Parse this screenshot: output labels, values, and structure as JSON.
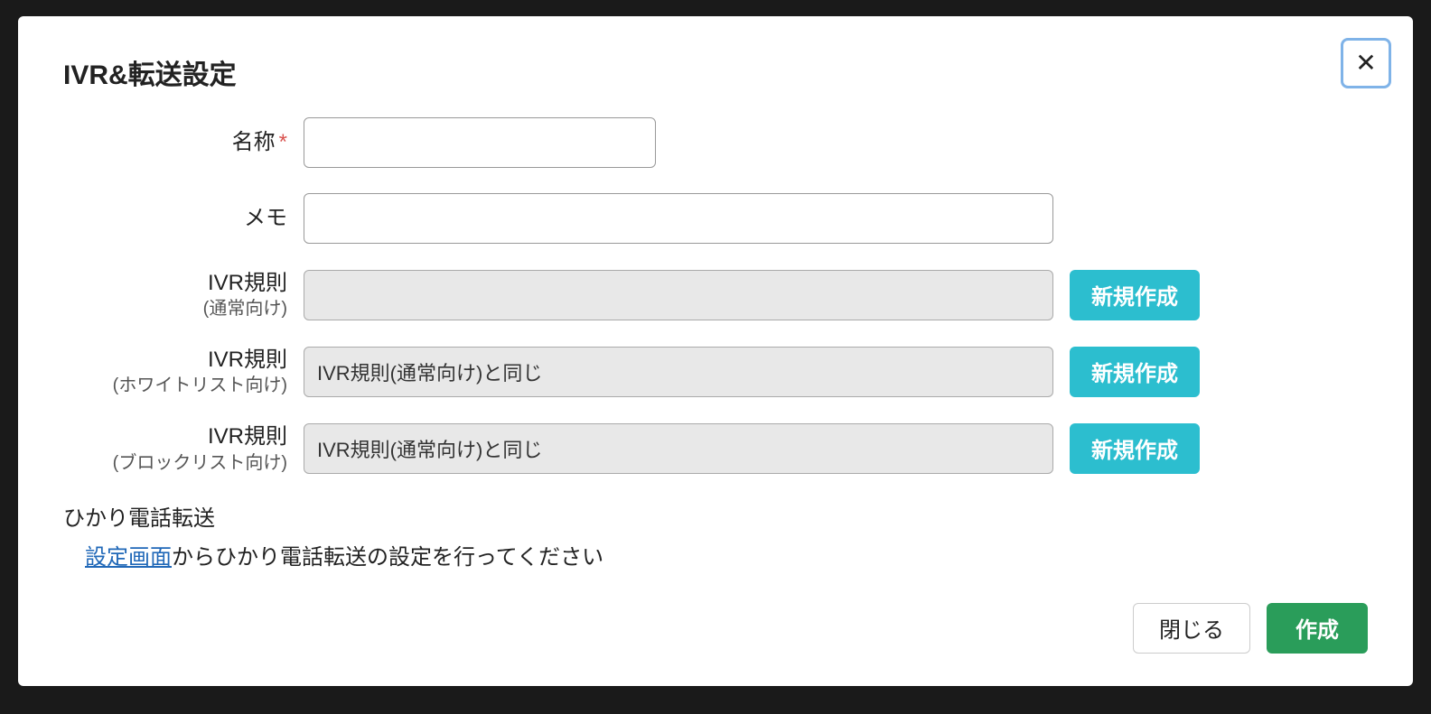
{
  "modal": {
    "title": "IVR&転送設定",
    "close_label": "✕"
  },
  "form": {
    "name": {
      "label": "名称",
      "required": "*",
      "value": ""
    },
    "memo": {
      "label": "メモ",
      "value": ""
    },
    "ivr_normal": {
      "label": "IVR規則",
      "sublabel": "(通常向け)",
      "value": "",
      "new_btn": "新規作成"
    },
    "ivr_whitelist": {
      "label": "IVR規則",
      "sublabel": "(ホワイトリスト向け)",
      "value": "IVR規則(通常向け)と同じ",
      "new_btn": "新規作成"
    },
    "ivr_blocklist": {
      "label": "IVR規則",
      "sublabel": "(ブロックリスト向け)",
      "value": "IVR規則(通常向け)と同じ",
      "new_btn": "新規作成"
    }
  },
  "hikari": {
    "title": "ひかり電話転送",
    "link_text": "設定画面",
    "help_text": "からひかり電話転送の設定を行ってください"
  },
  "footer": {
    "close": "閉じる",
    "create": "作成"
  }
}
